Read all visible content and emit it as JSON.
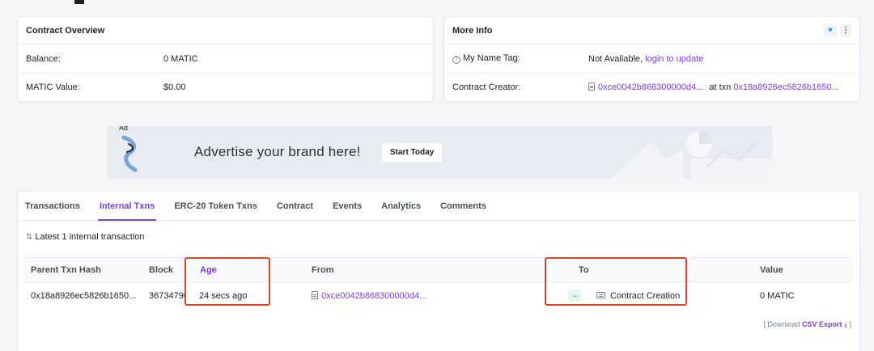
{
  "overview": {
    "title": "Contract Overview",
    "balance_label": "Balance:",
    "balance_value": "0 MATIC",
    "matic_value_label": "MATIC Value:",
    "matic_value": "$0.00"
  },
  "more_info": {
    "title": "More Info",
    "name_tag_label": "My Name Tag:",
    "name_tag_value": "Not Available,",
    "name_tag_link": "login to update",
    "creator_label": "Contract Creator:",
    "creator_address": "0xce0042b868300000d4...",
    "creator_at_txn": "at txn",
    "creator_txn": "0x18a8926ec5826b1650..."
  },
  "ad": {
    "badge": "Ad",
    "text": "Advertise your brand here!",
    "button": "Start Today"
  },
  "tabs": [
    {
      "label": "Transactions",
      "active": false
    },
    {
      "label": "Internal Txns",
      "active": true
    },
    {
      "label": "ERC-20 Token Txns",
      "active": false
    },
    {
      "label": "Contract",
      "active": false
    },
    {
      "label": "Events",
      "active": false
    },
    {
      "label": "Analytics",
      "active": false
    },
    {
      "label": "Comments",
      "active": false
    }
  ],
  "table": {
    "summary": "Latest 1 internal transaction",
    "columns": [
      "Parent Txn Hash",
      "Block",
      "Age",
      "From",
      "To",
      "Value"
    ],
    "rows": [
      {
        "parent_txn_hash": "0x18a8926ec5826b1650...",
        "block": "36734790",
        "age": "24 secs ago",
        "from": "0xce0042b868300000d4...",
        "to": "Contract Creation",
        "value": "0 MATIC"
      }
    ],
    "download_prefix": "[ Download",
    "download_link": "CSV Export",
    "download_suffix": "]"
  },
  "colors": {
    "accent": "#7b3fe4",
    "highlight": "#d9452b",
    "success": "#00a186"
  }
}
